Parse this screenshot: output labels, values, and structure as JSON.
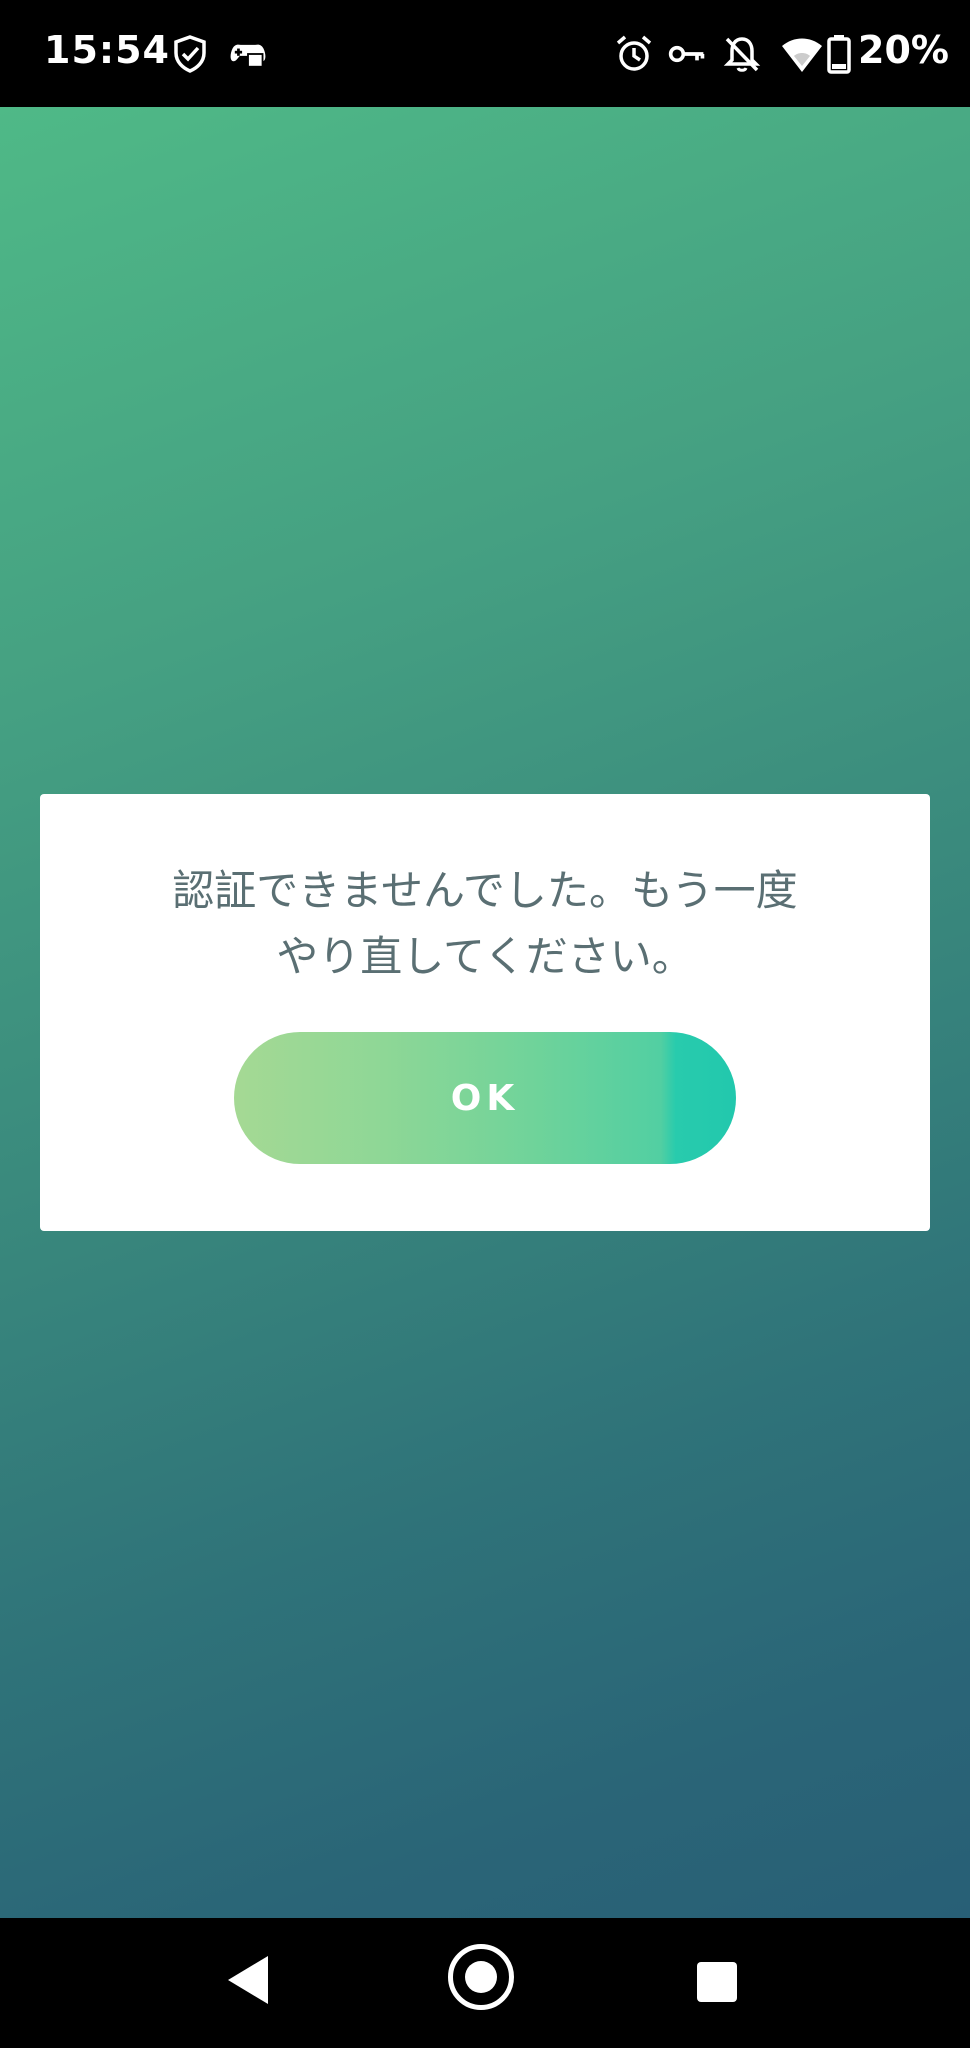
{
  "status_bar": {
    "time": "15:54",
    "battery_percent": "20%",
    "left_icons": [
      "shield-check-icon",
      "gamepad-icon"
    ],
    "right_icons": [
      "alarm-icon",
      "vpn-key-icon",
      "notifications-off-icon",
      "wifi-icon",
      "battery-icon"
    ]
  },
  "dialog": {
    "message": "認証できませんでした。もう一度\nやり直してください。",
    "ok_label": "OK"
  },
  "nav_bar": {
    "icons": [
      "back-icon",
      "home-icon",
      "recents-icon"
    ]
  },
  "colors": {
    "background_top": "#4fb987",
    "background_bottom": "#285f76",
    "button_start": "#a5d994",
    "button_end": "#22c8ad",
    "message_text": "#5a6f73"
  }
}
